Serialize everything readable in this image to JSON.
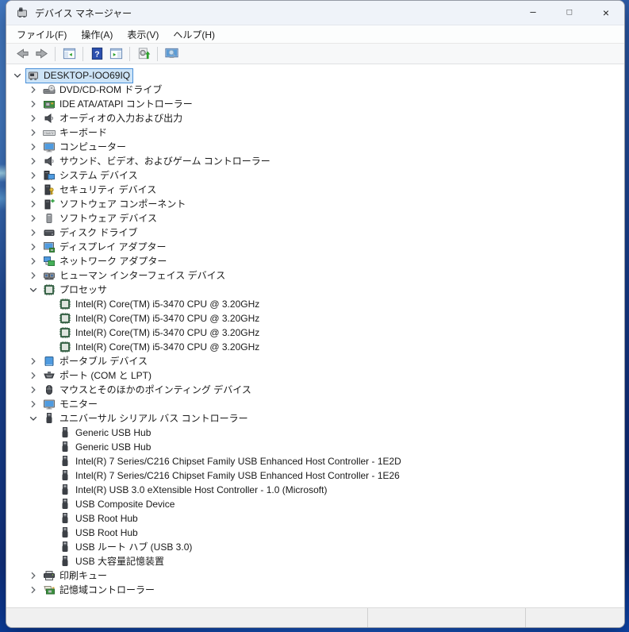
{
  "window": {
    "title": "デバイス マネージャー",
    "app_icon": "device-manager-icon",
    "controls": [
      {
        "name": "minimize-button",
        "icon": "minimize-icon",
        "glyph": "–"
      },
      {
        "name": "maximize-button",
        "icon": "maximize-icon",
        "glyph": "□"
      },
      {
        "name": "close-button",
        "icon": "close-icon",
        "glyph": "×"
      }
    ]
  },
  "menu": {
    "items": [
      {
        "id": "file",
        "label": "ファイル(F)"
      },
      {
        "id": "action",
        "label": "操作(A)"
      },
      {
        "id": "view",
        "label": "表示(V)"
      },
      {
        "id": "help",
        "label": "ヘルプ(H)"
      }
    ]
  },
  "toolbar": {
    "items": [
      {
        "name": "back-button",
        "icon": "arrow-left-icon"
      },
      {
        "name": "forward-button",
        "icon": "arrow-right-icon"
      },
      {
        "type": "separator"
      },
      {
        "name": "show-console-tree-button",
        "icon": "console-tree-icon"
      },
      {
        "type": "separator"
      },
      {
        "name": "help-button",
        "icon": "help-icon"
      },
      {
        "name": "show-action-pane-button",
        "icon": "action-pane-icon"
      },
      {
        "type": "separator"
      },
      {
        "name": "scan-hardware-changes-button",
        "icon": "scan-hardware-icon"
      },
      {
        "type": "separator"
      },
      {
        "name": "search-computer-button",
        "icon": "monitor-search-icon"
      }
    ]
  },
  "tree": {
    "items": [
      {
        "label": "DESKTOP-IOO69IQ",
        "level": 0,
        "state": "expanded",
        "icon": "computer-icon",
        "selected": true
      },
      {
        "label": "DVD/CD-ROM ドライブ",
        "level": 1,
        "state": "collapsed",
        "icon": "dvd-drive-icon"
      },
      {
        "label": "IDE ATA/ATAPI コントローラー",
        "level": 1,
        "state": "collapsed",
        "icon": "ide-controller-icon"
      },
      {
        "label": "オーディオの入力および出力",
        "level": 1,
        "state": "collapsed",
        "icon": "audio-icon"
      },
      {
        "label": "キーボード",
        "level": 1,
        "state": "collapsed",
        "icon": "keyboard-icon"
      },
      {
        "label": "コンピューター",
        "level": 1,
        "state": "collapsed",
        "icon": "monitor-icon"
      },
      {
        "label": "サウンド、ビデオ、およびゲーム コントローラー",
        "level": 1,
        "state": "collapsed",
        "icon": "sound-icon"
      },
      {
        "label": "システム デバイス",
        "level": 1,
        "state": "collapsed",
        "icon": "system-device-icon"
      },
      {
        "label": "セキュリティ デバイス",
        "level": 1,
        "state": "collapsed",
        "icon": "security-device-icon"
      },
      {
        "label": "ソフトウェア コンポーネント",
        "level": 1,
        "state": "collapsed",
        "icon": "software-component-icon"
      },
      {
        "label": "ソフトウェア デバイス",
        "level": 1,
        "state": "collapsed",
        "icon": "software-device-icon"
      },
      {
        "label": "ディスク ドライブ",
        "level": 1,
        "state": "collapsed",
        "icon": "disk-drive-icon"
      },
      {
        "label": "ディスプレイ アダプター",
        "level": 1,
        "state": "collapsed",
        "icon": "display-adapter-icon"
      },
      {
        "label": "ネットワーク アダプター",
        "level": 1,
        "state": "collapsed",
        "icon": "network-adapter-icon"
      },
      {
        "label": "ヒューマン インターフェイス デバイス",
        "level": 1,
        "state": "collapsed",
        "icon": "hid-icon"
      },
      {
        "label": "プロセッサ",
        "level": 1,
        "state": "expanded",
        "icon": "processor-icon"
      },
      {
        "label": "Intel(R) Core(TM) i5-3470 CPU @ 3.20GHz",
        "level": 2,
        "state": "leaf",
        "icon": "processor-icon"
      },
      {
        "label": "Intel(R) Core(TM) i5-3470 CPU @ 3.20GHz",
        "level": 2,
        "state": "leaf",
        "icon": "processor-icon"
      },
      {
        "label": "Intel(R) Core(TM) i5-3470 CPU @ 3.20GHz",
        "level": 2,
        "state": "leaf",
        "icon": "processor-icon"
      },
      {
        "label": "Intel(R) Core(TM) i5-3470 CPU @ 3.20GHz",
        "level": 2,
        "state": "leaf",
        "icon": "processor-icon"
      },
      {
        "label": "ポータブル デバイス",
        "level": 1,
        "state": "collapsed",
        "icon": "portable-device-icon"
      },
      {
        "label": "ポート (COM と LPT)",
        "level": 1,
        "state": "collapsed",
        "icon": "port-icon"
      },
      {
        "label": "マウスとそのほかのポインティング デバイス",
        "level": 1,
        "state": "collapsed",
        "icon": "mouse-icon"
      },
      {
        "label": "モニター",
        "level": 1,
        "state": "collapsed",
        "icon": "monitor-icon"
      },
      {
        "label": "ユニバーサル シリアル バス コントローラー",
        "level": 1,
        "state": "expanded",
        "icon": "usb-icon"
      },
      {
        "label": "Generic USB Hub",
        "level": 2,
        "state": "leaf",
        "icon": "usb-icon"
      },
      {
        "label": "Generic USB Hub",
        "level": 2,
        "state": "leaf",
        "icon": "usb-icon"
      },
      {
        "label": "Intel(R) 7 Series/C216 Chipset Family USB Enhanced Host Controller - 1E2D",
        "level": 2,
        "state": "leaf",
        "icon": "usb-icon"
      },
      {
        "label": "Intel(R) 7 Series/C216 Chipset Family USB Enhanced Host Controller - 1E26",
        "level": 2,
        "state": "leaf",
        "icon": "usb-icon"
      },
      {
        "label": "Intel(R) USB 3.0 eXtensible Host Controller - 1.0 (Microsoft)",
        "level": 2,
        "state": "leaf",
        "icon": "usb-icon"
      },
      {
        "label": "USB Composite Device",
        "level": 2,
        "state": "leaf",
        "icon": "usb-icon"
      },
      {
        "label": "USB Root Hub",
        "level": 2,
        "state": "leaf",
        "icon": "usb-icon"
      },
      {
        "label": "USB Root Hub",
        "level": 2,
        "state": "leaf",
        "icon": "usb-icon"
      },
      {
        "label": "USB ルート ハブ (USB 3.0)",
        "level": 2,
        "state": "leaf",
        "icon": "usb-icon"
      },
      {
        "label": "USB 大容量記憶装置",
        "level": 2,
        "state": "leaf",
        "icon": "usb-icon"
      },
      {
        "label": "印刷キュー",
        "level": 1,
        "state": "collapsed",
        "icon": "printer-icon"
      },
      {
        "label": "記憶域コントローラー",
        "level": 1,
        "state": "collapsed",
        "icon": "storage-controller-icon"
      }
    ]
  },
  "statusbar": {
    "segments": [
      "",
      "",
      ""
    ]
  },
  "colors": {
    "selection_fill": "#cde4f7",
    "selection_border": "#4a90d9",
    "titlebar_bg": "#eff3f9",
    "statusbar_bg": "#f0f0f0",
    "wallpaper_blue": "#1e4f9e"
  }
}
